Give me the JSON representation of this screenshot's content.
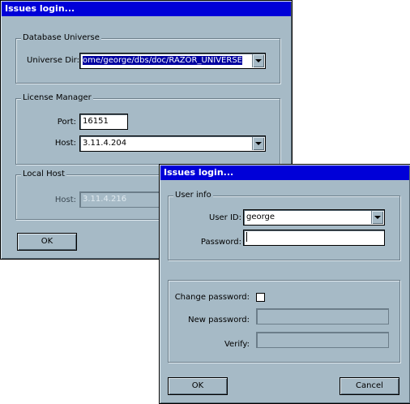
{
  "back_window": {
    "title": "Issues login...",
    "db_group": {
      "title": "Database Universe",
      "dir_label": "Universe Dir:",
      "dir_value": "ome/george/dbs/doc/RAZOR_UNIVERSE"
    },
    "license_group": {
      "title": "License Manager",
      "port_label": "Port:",
      "port_value": "16151",
      "host_label": "Host:",
      "host_value": "3.11.4.204"
    },
    "local_group": {
      "title": "Local Host",
      "host_label": "Host:",
      "host_value": "3.11.4.216"
    },
    "ok_label": "OK"
  },
  "front_window": {
    "title": "Issues login...",
    "user_group": {
      "title": "User info",
      "userid_label": "User ID:",
      "userid_value": "george",
      "password_label": "Password:",
      "password_value": ""
    },
    "change_group": {
      "change_label": "Change password:",
      "change_checked": false,
      "newpw_label": "New password:",
      "verify_label": "Verify:"
    },
    "ok_label": "OK",
    "cancel_label": "Cancel"
  }
}
